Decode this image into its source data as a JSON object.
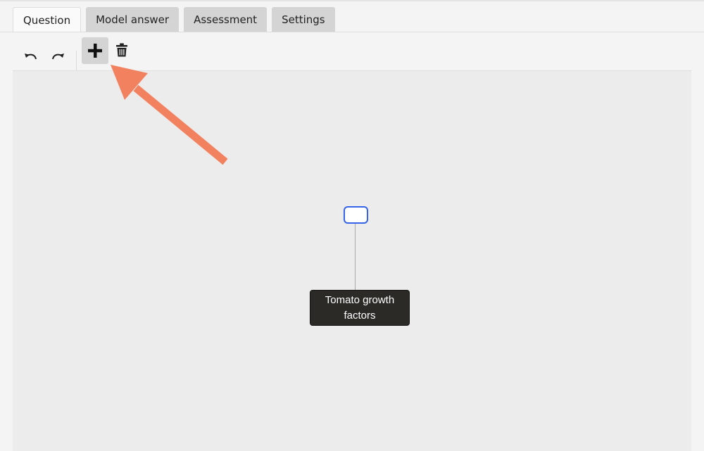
{
  "tabs": [
    {
      "label": "Question",
      "active": true
    },
    {
      "label": "Model answer",
      "active": false
    },
    {
      "label": "Assessment",
      "active": false
    },
    {
      "label": "Settings",
      "active": false
    }
  ],
  "toolbar": {
    "undo_icon": "undo-icon",
    "redo_icon": "redo-icon",
    "add_icon": "plus-icon",
    "delete_icon": "trash-icon"
  },
  "map": {
    "root_node": {
      "label": "Tomato growth factors"
    },
    "child_node": {
      "label": "",
      "selected": true
    }
  },
  "annotation": {
    "type": "arrow",
    "color": "#f28160",
    "points_to": "add-button"
  },
  "colors": {
    "node_selected_border": "#3563e9",
    "root_node_bg": "#2b2a27",
    "canvas_bg": "#ececec"
  }
}
